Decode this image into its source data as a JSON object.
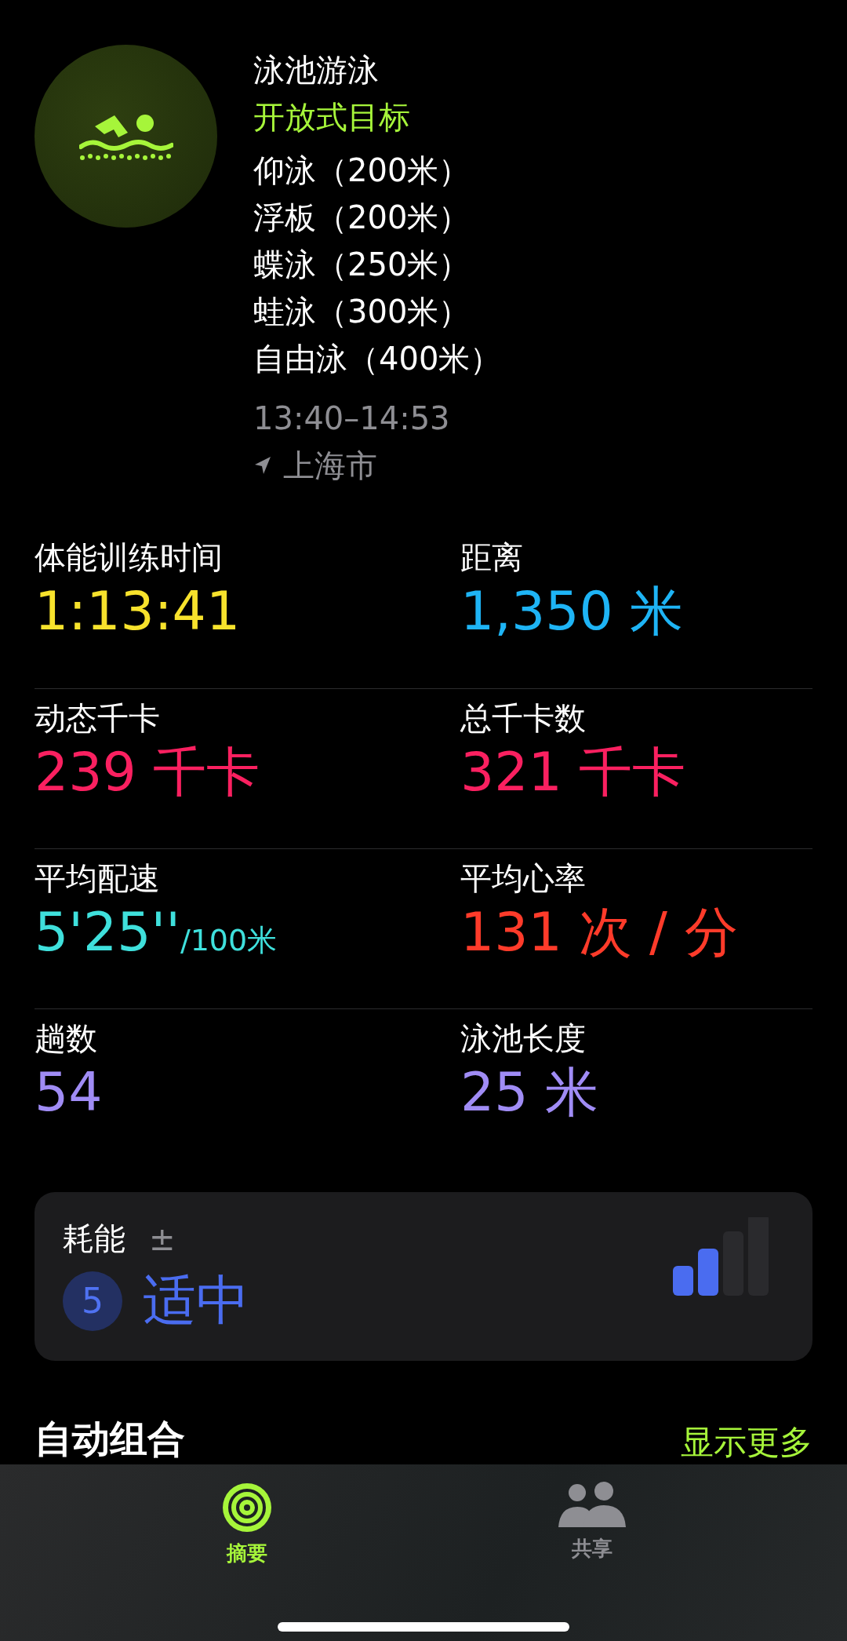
{
  "workout": {
    "title": "泳池游泳",
    "goal": "开放式目标",
    "sets": [
      "仰泳（200米）",
      "浮板（200米）",
      "蝶泳（250米）",
      "蛙泳（300米）",
      "自由泳（400米）"
    ],
    "time": "13:40–14:53",
    "location": "上海市"
  },
  "metrics": [
    {
      "label": "体能训练时间",
      "value": "1:13:41",
      "color": "#f7e22c"
    },
    {
      "label": "距离",
      "value": "1,350 米",
      "color": "#1eb4f5"
    },
    {
      "label": "动态千卡",
      "value": "239 千卡",
      "color": "#fa2060"
    },
    {
      "label": "总千卡数",
      "value": "321 千卡",
      "color": "#fa2060"
    },
    {
      "label": "平均配速",
      "value": "5'25''",
      "suffix": "/100米",
      "color": "#3fe0dc"
    },
    {
      "label": "平均心率",
      "value": "131 次 / 分",
      "color": "#ff3b2a"
    },
    {
      "label": "趟数",
      "value": "54",
      "color": "#a08cf5"
    },
    {
      "label": "泳池长度",
      "value": "25 米",
      "color": "#a08cf5"
    }
  ],
  "effort": {
    "title": "耗能",
    "adjust": "±",
    "score": "5",
    "rating": "适中",
    "level": 0.5
  },
  "section": {
    "title": "自动组合",
    "action": "显示更多"
  },
  "tabs": [
    {
      "label": "摘要",
      "kind": "activity",
      "selected": true
    },
    {
      "label": "共享",
      "kind": "sharing",
      "selected": false
    }
  ]
}
